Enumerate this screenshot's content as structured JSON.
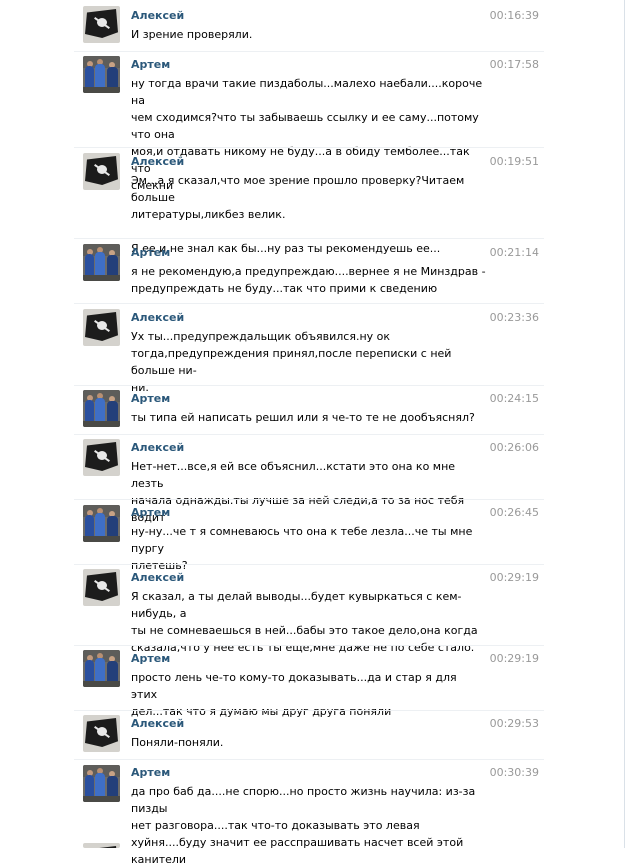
{
  "messages": [
    {
      "author": "Алексей",
      "time": "00:16:39",
      "avatar": "pirate-flag-avatar",
      "text": "И зрение проверяли."
    },
    {
      "author": "Артем",
      "time": "00:17:58",
      "avatar": "group-photo-avatar",
      "text": "ну тогда врачи такие пиздаболы...малехо наебали....короче на\nчем сходимся?что ты забываешь ссылку и ее саму...потому что она\nмоя,и отдавать никому не буду...а в обиду темболее...так что\nсмекни"
    },
    {
      "author": "Алексей",
      "time": "00:19:51",
      "avatar": "pirate-flag-avatar",
      "text": "Эм...а я сказал,что мое зрение прошло проверку?Читаем больше\nлитературы,ликбез велик.\n\nЯ ее и не знал как бы...ну раз ты рекомендуешь ее..."
    },
    {
      "author": "Артем",
      "time": "00:21:14",
      "avatar": "group-photo-avatar",
      "text": "я не рекомендую,а предупреждаю....вернее я не Минздрав -\nпредупреждать не буду...так что прими к сведению"
    },
    {
      "author": "Алексей",
      "time": "00:23:36",
      "avatar": "pirate-flag-avatar",
      "text": "Ух ты...предупреждальщик объявился.ну ок\nтогда,предупреждения принял,после переписки с ней больше ни-\nни."
    },
    {
      "author": "Артем",
      "time": "00:24:15",
      "avatar": "group-photo-avatar",
      "text": "ты типа ей написать решил или я че-то те не дообъяснял?"
    },
    {
      "author": "Алексей",
      "time": "00:26:06",
      "avatar": "pirate-flag-avatar",
      "text": "Нет-нет...все,я ей все объяснил...кстати это она ко мне лезть\nначала однажды.ты лучше за ней следи,а то за нос тебя водит"
    },
    {
      "author": "Артем",
      "time": "00:26:45",
      "avatar": "group-photo-avatar",
      "text": "ну-ну...че т я сомневаюсь что она к тебе лезла...че ты мне пургу\nплетешь?"
    },
    {
      "author": "Алексей",
      "time": "00:29:19",
      "avatar": "pirate-flag-avatar",
      "text": "Я сказал, а ты делай выводы...будет кувыркаться с кем-нибудь, а\nты не сомневаешься в ней...бабы это такое дело,она когда\nсказала,что у нее есть ты еще,мне даже не по себе стало."
    },
    {
      "author": "Артем",
      "time": "00:29:19",
      "avatar": "group-photo-avatar",
      "text": "просто лень че-то кому-то доказывать...да и стар я для этих\nдел...так что я думаю мы друг друга поняли"
    },
    {
      "author": "Алексей",
      "time": "00:29:53",
      "avatar": "pirate-flag-avatar",
      "text": "Поняли-поняли."
    },
    {
      "author": "Артем",
      "time": "00:30:39",
      "avatar": "group-photo-avatar",
      "text": "да про баб да....не спорю...но просто жизнь научила: из-за пизды\nнет разговора....так что-то доказывать это левая\nхуйня....буду значит ее расспрашивать насчет всей этой канители"
    }
  ]
}
